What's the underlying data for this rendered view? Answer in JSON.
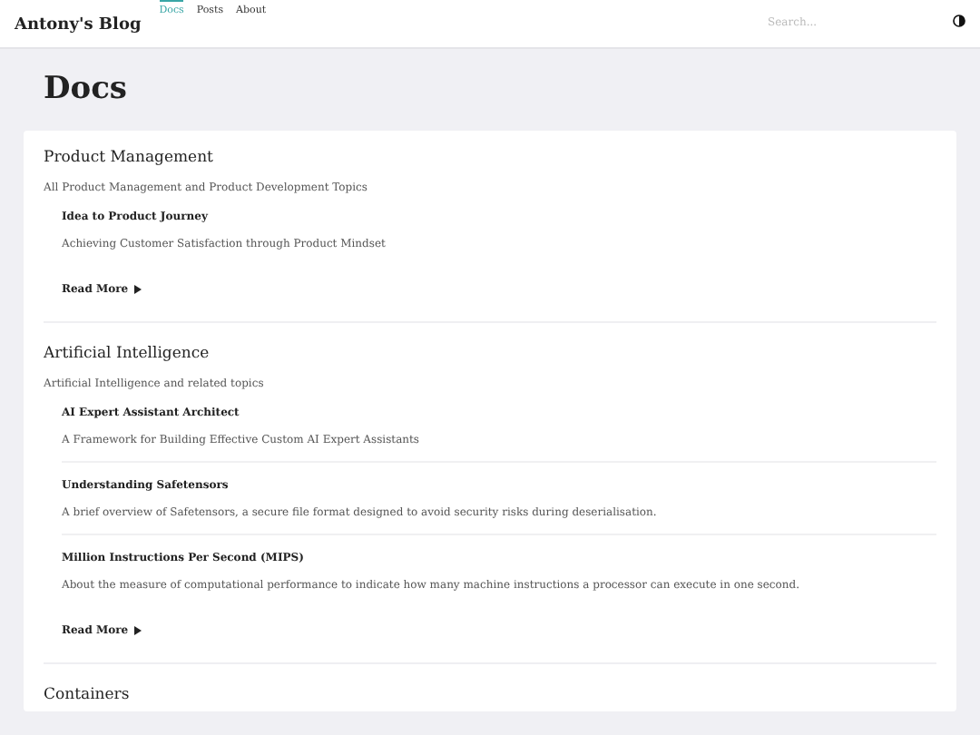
{
  "header": {
    "brand": "Antony's Blog",
    "nav": [
      {
        "label": "Docs",
        "selected": true
      },
      {
        "label": "Posts",
        "selected": false
      },
      {
        "label": "About",
        "selected": false
      }
    ],
    "search": {
      "placeholder": "Search..."
    }
  },
  "page_title": "Docs",
  "sections": [
    {
      "title": "Product Management",
      "description": "All Product Management and Product Development Topics",
      "items": [
        {
          "title": "Idea to Product Journey",
          "summary": "Achieving Customer Satisfaction through Product Mindset"
        }
      ],
      "read_more": "Read More"
    },
    {
      "title": "Artificial Intelligence",
      "description": "Artificial Intelligence and related topics",
      "items": [
        {
          "title": "AI Expert Assistant Architect",
          "summary": "A Framework for Building Effective Custom AI Expert Assistants"
        },
        {
          "title": "Understanding Safetensors",
          "summary": "A brief overview of Safetensors, a secure file format designed to avoid security risks during deserialisation."
        },
        {
          "title": "Million Instructions Per Second (MIPS)",
          "summary": "About the measure of computational performance to indicate how many machine instructions a processor can execute in one second."
        }
      ],
      "read_more": "Read More"
    },
    {
      "title": "Containers"
    }
  ]
}
